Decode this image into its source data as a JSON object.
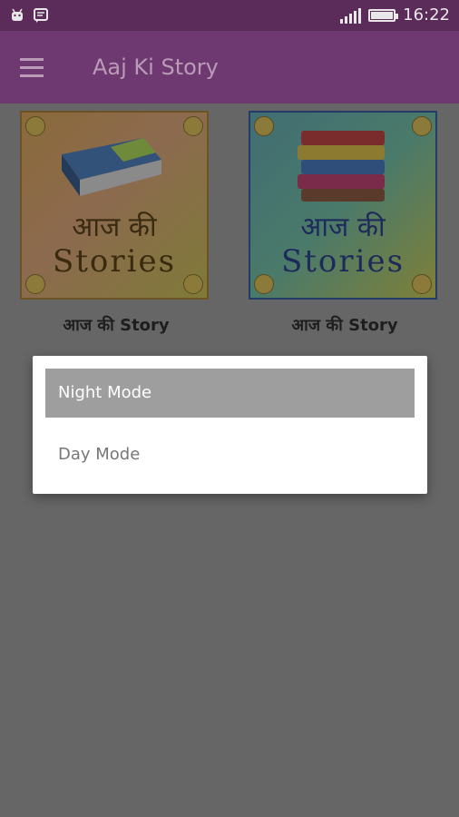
{
  "status_bar": {
    "time": "16:22",
    "left_icons": [
      "android-icon",
      "message-icon"
    ],
    "right_icons": [
      "signal-icon",
      "battery-icon"
    ]
  },
  "app_bar": {
    "title": "Aaj Ki Story",
    "menu_icon": "hamburger-icon"
  },
  "cards": [
    {
      "hindi_text": "आज की",
      "english_text": "Stories",
      "label": "आज की Story"
    },
    {
      "hindi_text": "आज की",
      "english_text": "Stories",
      "label": "आज की Story"
    }
  ],
  "dialog": {
    "options": [
      {
        "label": "Night Mode",
        "selected": true
      },
      {
        "label": "Day Mode",
        "selected": false
      }
    ]
  },
  "colors": {
    "status_bar": "#5b2c5a",
    "app_bar": "#6e3970",
    "overlay_background": "#666666",
    "selected_option": "#9e9e9e"
  }
}
